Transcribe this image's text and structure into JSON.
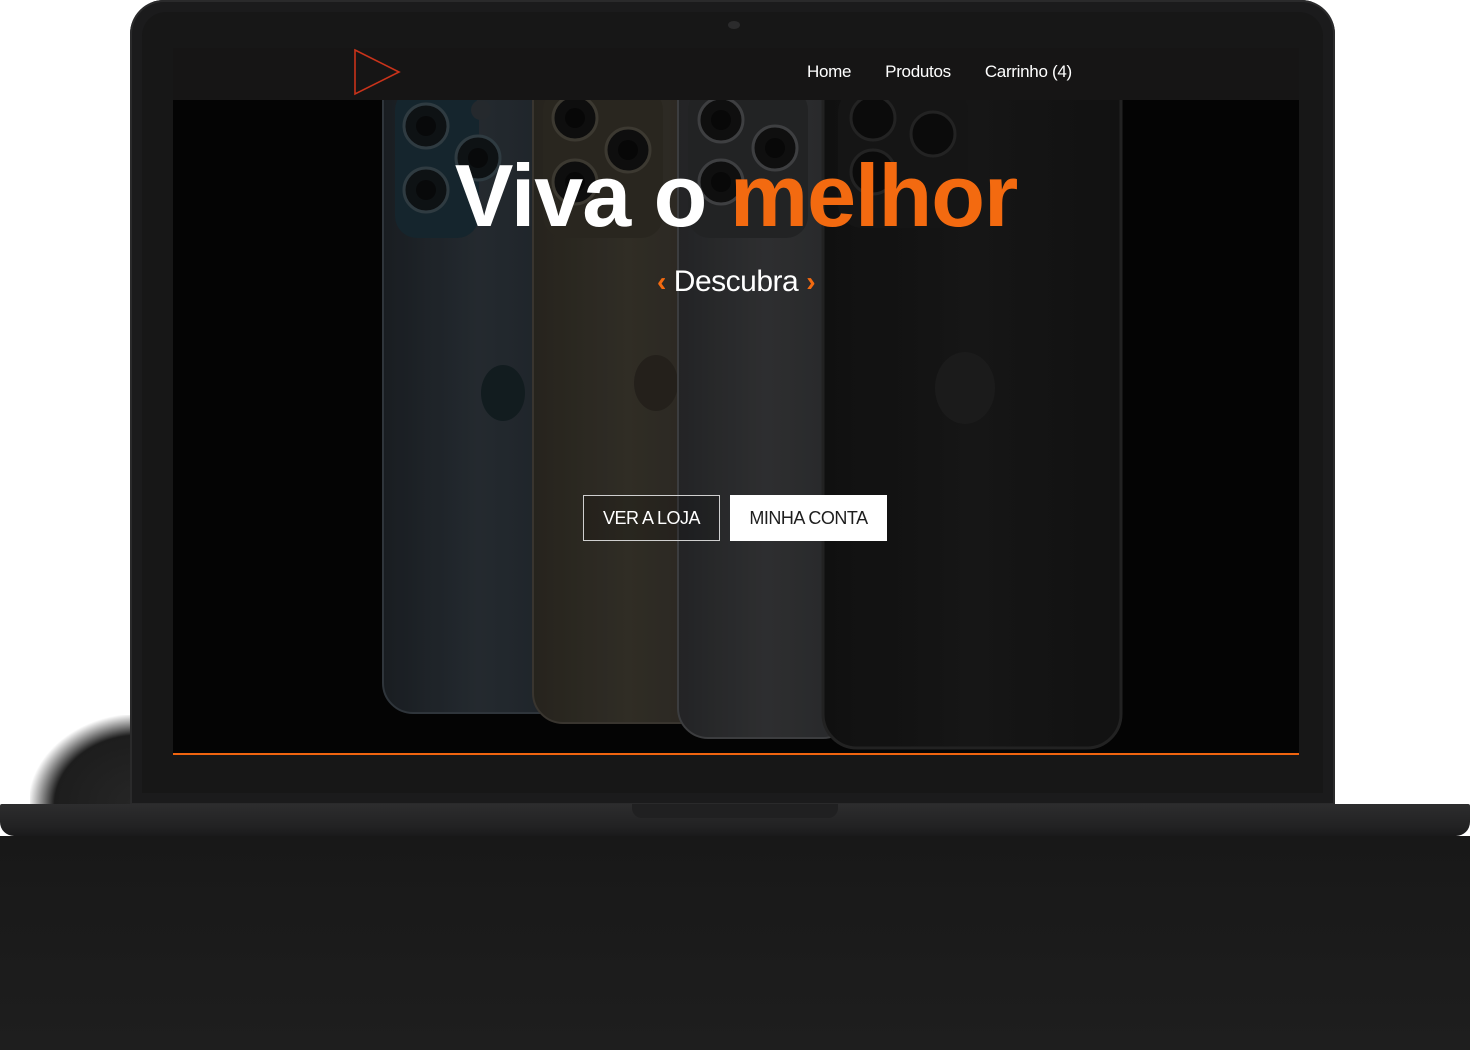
{
  "nav": {
    "items": [
      {
        "label": "Home"
      },
      {
        "label": "Produtos"
      },
      {
        "label": "Carrinho (4)"
      }
    ]
  },
  "hero": {
    "title_part1": "Viva o",
    "title_accent": "melhor",
    "subtitle": "Descubra",
    "chevron_left": "‹",
    "chevron_right": "›"
  },
  "buttons": {
    "store_label": "VER A LOJA",
    "account_label": "MINHA CONTA"
  },
  "colors": {
    "accent": "#f36a10",
    "nav_bg": "#161515",
    "screen_bg": "#050505"
  },
  "icons": {
    "logo": "play-triangle-icon",
    "brand": "apple-logo-icon"
  }
}
